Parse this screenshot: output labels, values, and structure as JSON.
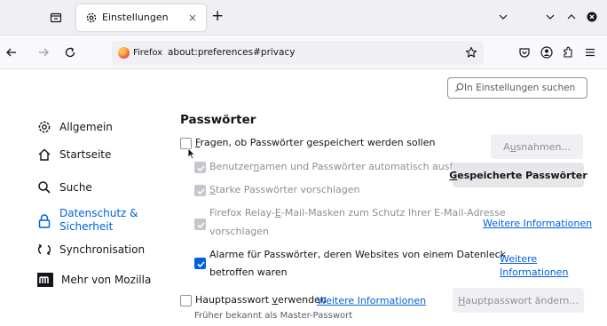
{
  "browser": {
    "tab": {
      "title": "Einstellungen"
    },
    "url": {
      "identity_label": "Firefox",
      "address": "about:preferences#privacy"
    }
  },
  "search": {
    "placeholder": "In Einstellungen suchen"
  },
  "sidebar": {
    "items": [
      {
        "label": "Allgemein",
        "icon": "gear-icon"
      },
      {
        "label": "Startseite",
        "icon": "home-icon"
      },
      {
        "label": "Suche",
        "icon": "search-icon"
      },
      {
        "label": "Datenschutz & Sicherheit",
        "icon": "lock-icon",
        "selected": true
      },
      {
        "label": "Synchronisation",
        "icon": "sync-icon"
      },
      {
        "label": "Mehr von Mozilla",
        "icon": "mozilla-logo-icon"
      }
    ]
  },
  "passwords": {
    "title": "Passwörter",
    "ask_save": {
      "prefix": "",
      "access_key": "F",
      "rest": "ragen, ob Passwörter gespeichert werden sollen",
      "checked": false
    },
    "autofill": {
      "prefix": "Benutzer",
      "access_key": "n",
      "rest": "amen und Passwörter automatisch ausfüllen",
      "checked": true,
      "disabled": true
    },
    "suggest": {
      "prefix": "",
      "access_key": "S",
      "rest": "tarke Passwörter vorschlagen",
      "checked": true,
      "disabled": true
    },
    "relay": {
      "line1_prefix": "Firefox Relay-",
      "access_key": "E",
      "line1_rest": "-Mail-Masken zum Schutz Ihrer E-Mail-Adresse",
      "line2": "vorschlagen",
      "checked": true,
      "disabled": true
    },
    "breach_alerts": {
      "line1": "Alarme für Passwörter, deren Websites von einem Datenleck",
      "line2": "betroffen waren",
      "checked": true
    },
    "primary_password": {
      "prefix": "Hauptpasswort ",
      "access_key": "v",
      "rest": "erwenden",
      "checked": false
    },
    "primary_password_note": "Früher bekannt als Master-Passwort",
    "exceptions_button": {
      "prefix": "A",
      "access_key": "u",
      "rest": "snahmen..."
    },
    "saved_logins_button": {
      "access_key": "G",
      "rest": "espeicherte Passwörter"
    },
    "change_primary_button": {
      "access_key": "H",
      "rest": "auptpasswort ändern..."
    },
    "learn_more_relay": "Weitere Informationen",
    "learn_more_breach": {
      "line1": "Weitere",
      "line2": "Informationen"
    },
    "learn_more_primary": "Weitere Informationen"
  },
  "colors": {
    "accent": "#0061e0",
    "text": "#15141a",
    "disabled_text": "#8e8e95",
    "chrome": "#f0f0f4"
  }
}
